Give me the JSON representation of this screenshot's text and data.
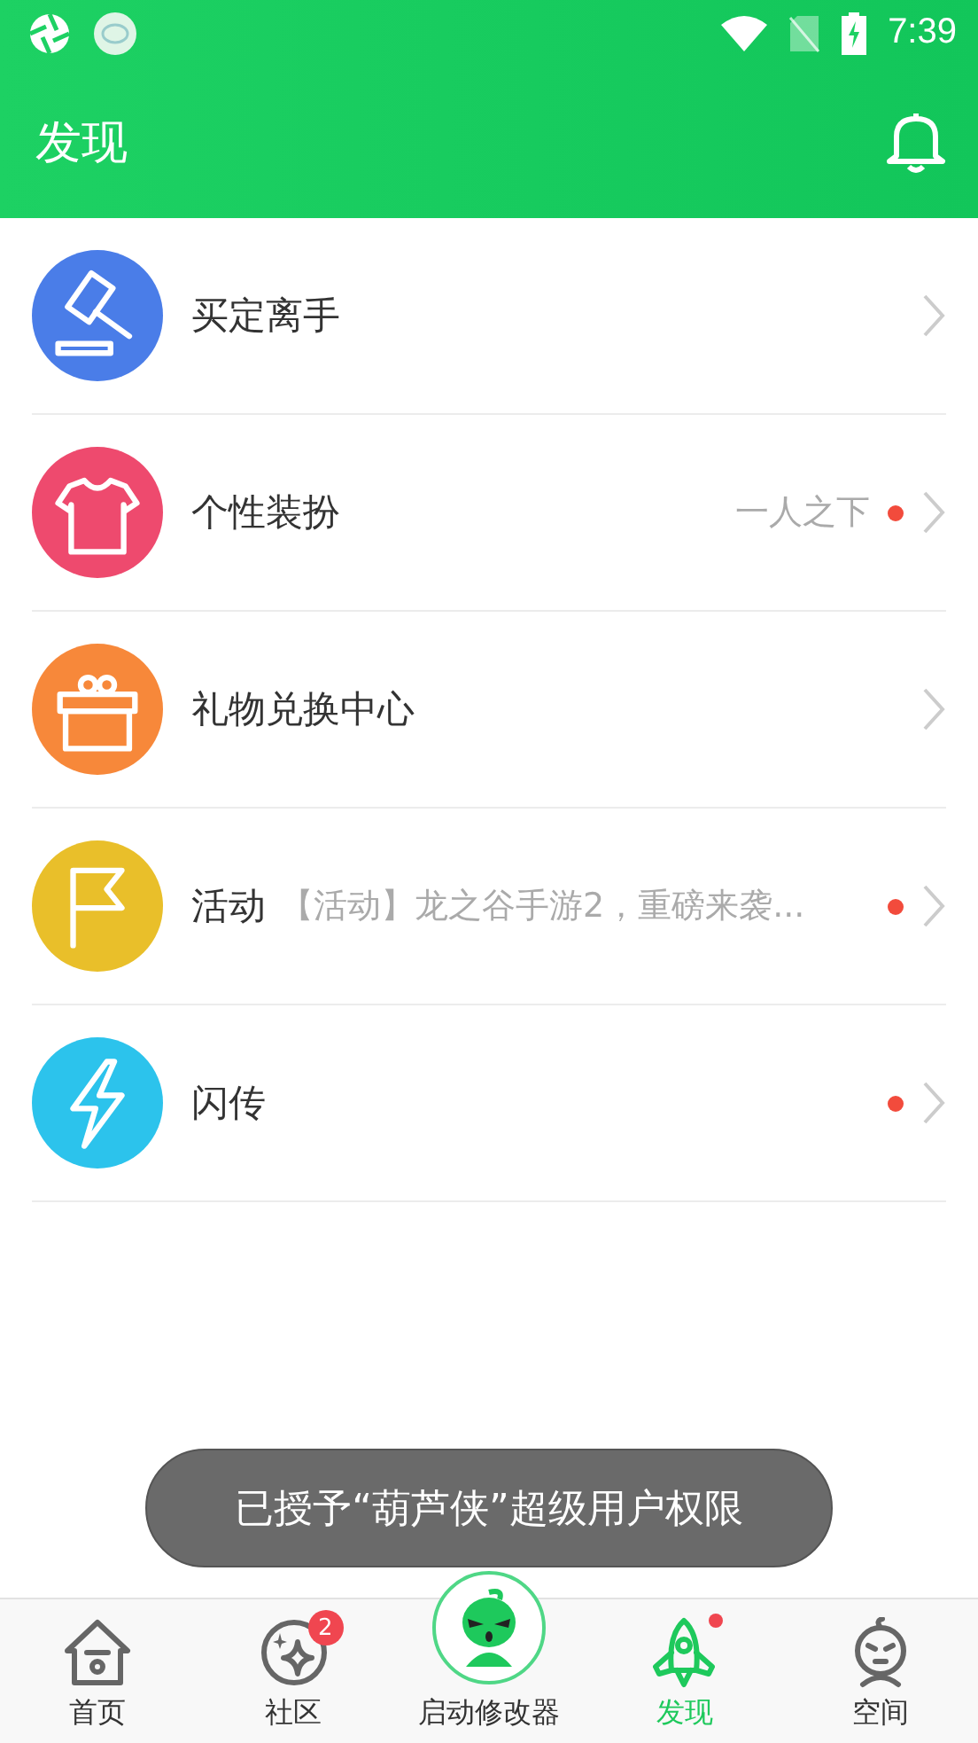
{
  "status_bar": {
    "time": "7:39"
  },
  "app_bar": {
    "title": "发现"
  },
  "items": [
    {
      "kind": "gavel",
      "color": "#4a7de8",
      "title": "买定离手",
      "dot": false
    },
    {
      "kind": "shirt",
      "color": "#ee4a6e",
      "title": "个性装扮",
      "subtitle": "一人之下",
      "dot": true
    },
    {
      "kind": "gift",
      "color": "#f7883a",
      "title": "礼物兑换中心",
      "dot": false
    },
    {
      "kind": "flag",
      "color": "#e9bf2a",
      "title": "活动",
      "subtitle": "【活动】龙之谷手游2，重磅来袭...",
      "dot": true
    },
    {
      "kind": "bolt",
      "color": "#2cc3ec",
      "title": "闪传",
      "dot": true
    }
  ],
  "toast": "已授予“葫芦侠”超级用户权限",
  "nav": [
    {
      "kind": "home",
      "label": "首页",
      "selected": false,
      "dot": false
    },
    {
      "kind": "stars",
      "label": "社区",
      "selected": false,
      "badge": "2",
      "dot": false
    },
    {
      "kind": "center",
      "label": "启动修改器",
      "selected": false,
      "dot": false
    },
    {
      "kind": "rocket",
      "label": "发现",
      "selected": true,
      "dot": true
    },
    {
      "kind": "face",
      "label": "空间",
      "selected": false,
      "dot": false
    }
  ]
}
